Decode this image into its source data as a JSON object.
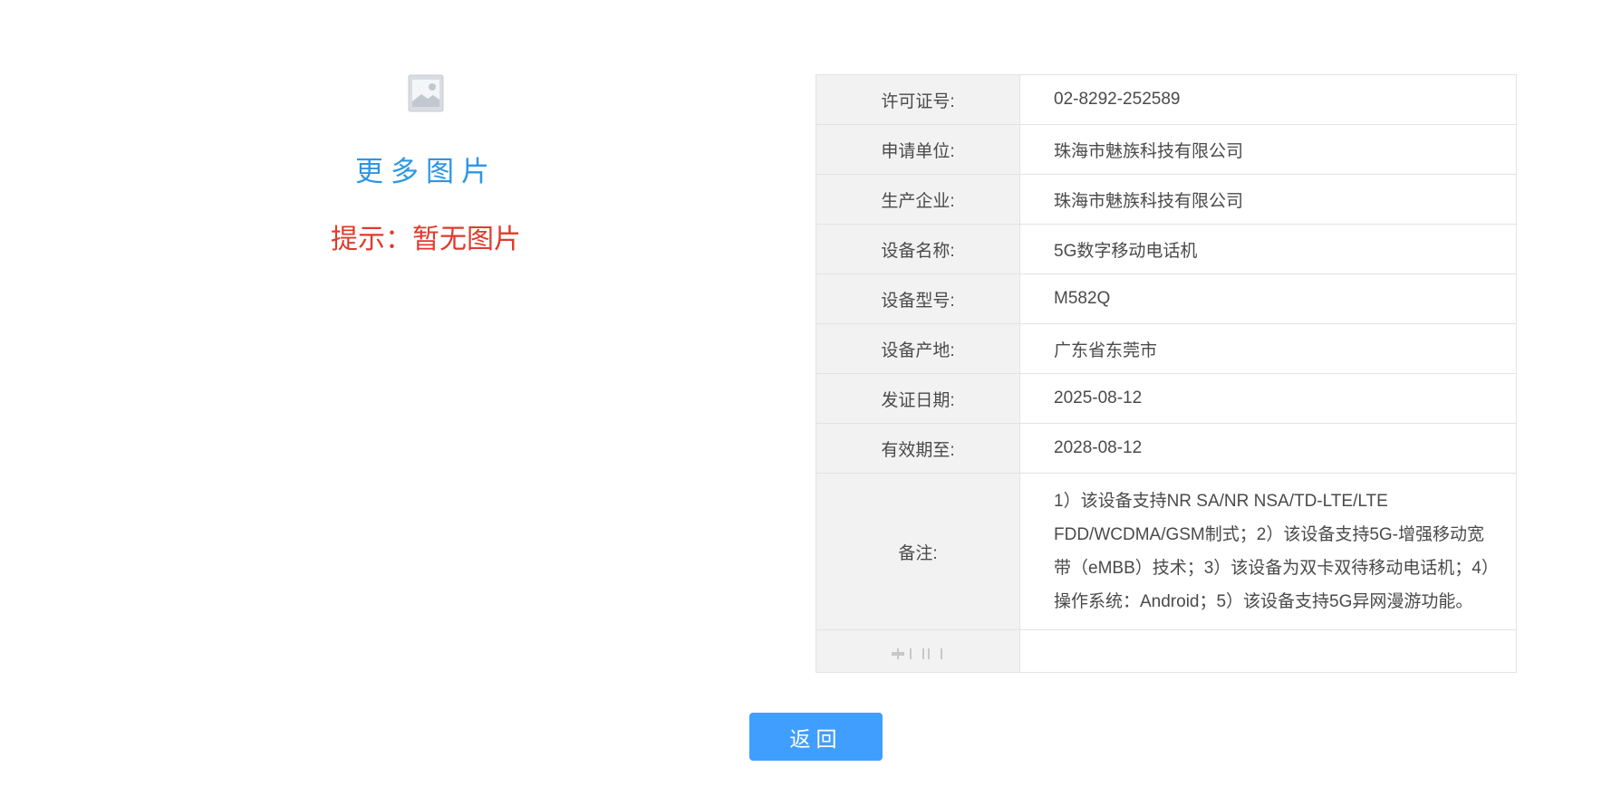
{
  "left_panel": {
    "image_icon": "broken-image-icon",
    "more_images_label": "更多图片",
    "hint_text": "提示：暂无图片"
  },
  "info_table": {
    "rows": [
      {
        "label": "许可证号:",
        "value": "02-8292-252589"
      },
      {
        "label": "申请单位:",
        "value": "珠海市魅族科技有限公司"
      },
      {
        "label": "生产企业:",
        "value": "珠海市魅族科技有限公司"
      },
      {
        "label": "设备名称:",
        "value": "5G数字移动电话机"
      },
      {
        "label": "设备型号:",
        "value": "M582Q"
      },
      {
        "label": "设备产地:",
        "value": "广东省东莞市"
      },
      {
        "label": "发证日期:",
        "value": "2025-08-12"
      },
      {
        "label": "有效期至:",
        "value": "2028-08-12"
      },
      {
        "label": "备注:",
        "value": "1）该设备支持NR SA/NR NSA/TD-LTE/LTE FDD/WCDMA/GSM制式；2）该设备支持5G-增强移动宽带（eMBB）技术；3）该设备为双卡双待移动电话机；4）操作系统：Android；5）该设备支持5G异网漫游功能。"
      },
      {
        "label": "",
        "value": ""
      }
    ]
  },
  "footer": {
    "back_label": "返回"
  },
  "colors": {
    "link_blue": "#2d96e6",
    "hint_red": "#e03a2c",
    "button_blue": "#409eff",
    "label_bg": "#f2f2f2",
    "border": "#e3e3e3"
  }
}
